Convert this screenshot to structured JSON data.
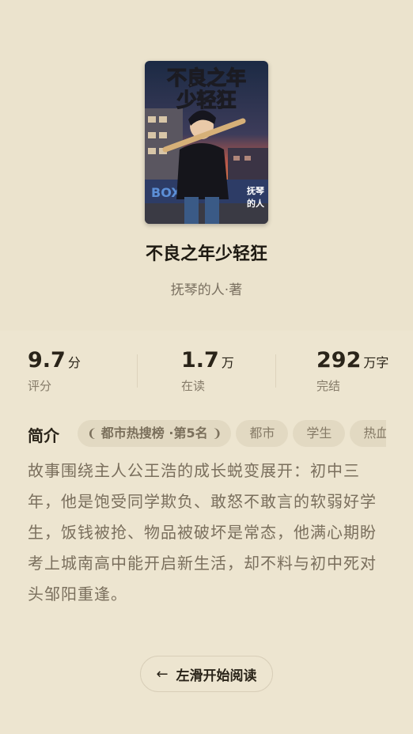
{
  "book": {
    "title": "不良之年少轻狂",
    "author": "抚琴的人·著",
    "cover": {
      "title_line1": "不良之年",
      "title_line2": "少轻狂",
      "side_text_line1": "抚琴",
      "side_text_line2": "的人"
    }
  },
  "stats": [
    {
      "value": "9.7",
      "unit": "分",
      "label": "评分"
    },
    {
      "value": "1.7",
      "unit": "万",
      "label": "在读"
    },
    {
      "value": "292",
      "unit": "万字",
      "label": "完结"
    }
  ],
  "intro": {
    "label": "简介",
    "tags": {
      "rank": "都市热搜榜 ·第5名",
      "t1": "都市",
      "t2": "学生",
      "t3": "热血"
    },
    "text": "故事围绕主人公王浩的成长蜕变展开：初中三年，他是饱受同学欺负、敢怒不敢言的软弱好学生，饭钱被抢、物品被破坏是常态，他满心期盼考上城南高中能开启新生活，却不料与初中死对头邹阳重逢。"
  },
  "action": {
    "read_label": "左滑开始阅读",
    "arrow_icon": "arrow-left-icon"
  },
  "colors": {
    "background": "#ede5d0",
    "tag_bg": "#e2d9c2",
    "text_primary": "#2a2419",
    "text_secondary": "#7a6f5d"
  }
}
